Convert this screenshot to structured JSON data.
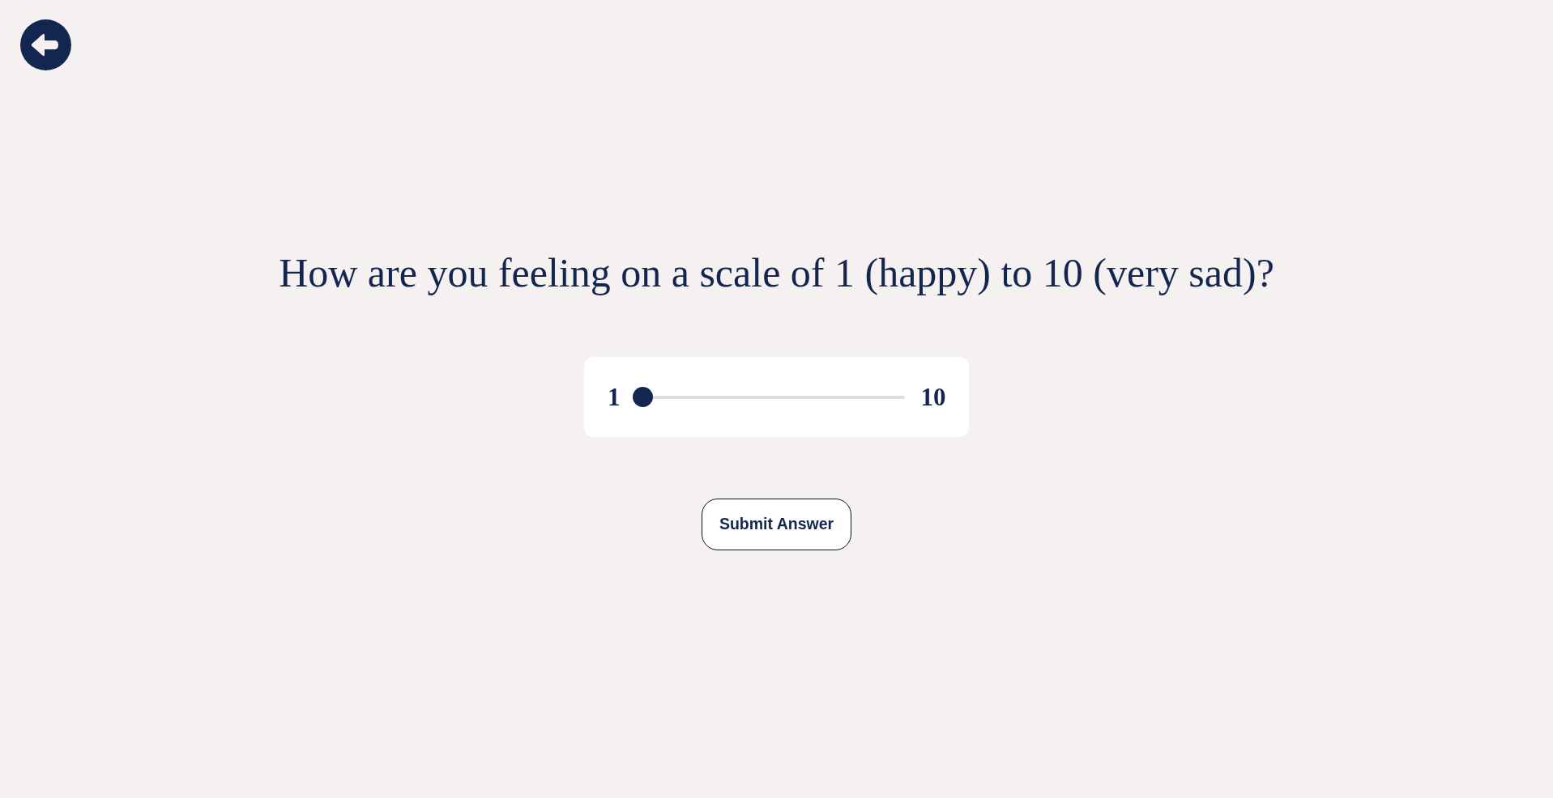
{
  "question": "How are you feeling on a scale of 1 (happy) to 10 (very sad)?",
  "slider": {
    "min_label": "1",
    "max_label": "10",
    "level": 0
  },
  "submit_button": {
    "label": "Submit Answer"
  }
}
